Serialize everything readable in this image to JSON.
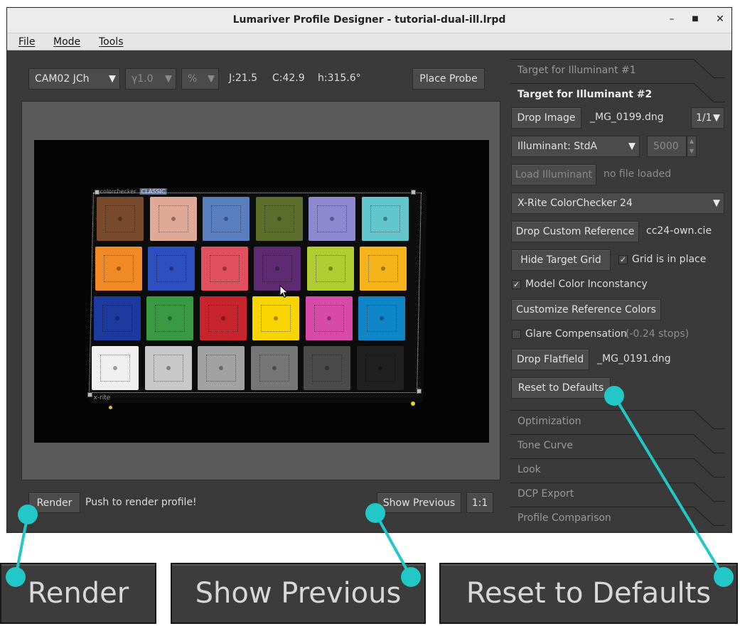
{
  "window": {
    "title": "Lumariver Profile Designer - tutorial-dual-ill.lrpd",
    "minimize": "–",
    "maximize": "■",
    "close": "✕"
  },
  "menu": [
    "File",
    "Mode",
    "Tools"
  ],
  "toolbar": {
    "colorspace": "CAM02 JCh",
    "gamma": "γ1.0",
    "unit": "%",
    "j": "J:21.5",
    "c": "C:42.9",
    "h": "h:315.6°",
    "place_probe": "Place Probe"
  },
  "bottom": {
    "render": "Render",
    "render_status": "Push to render profile!",
    "show_previous": "Show Previous",
    "zoom": "1:1"
  },
  "panel": {
    "tab_ill1": "Target for Illuminant #1",
    "tab_ill2": "Target for Illuminant #2",
    "drop_image": "Drop Image",
    "image_file": "_MG_0199.dng",
    "page_select": "1/1",
    "illuminant": "Illuminant: StdA",
    "temperature": "5000",
    "load_illuminant": "Load Illuminant",
    "illuminant_file": "no file loaded",
    "target_type": "X-Rite ColorChecker 24",
    "drop_custom_ref": "Drop Custom Reference",
    "custom_ref_file": "cc24-own.cie",
    "hide_grid": "Hide Target Grid",
    "grid_in_place": "Grid is in place",
    "grid_in_place_checked": true,
    "model_inconstancy": "Model Color Inconstancy",
    "model_inconstancy_checked": true,
    "customize_ref": "Customize Reference Colors",
    "glare": "Glare Compensation",
    "glare_value": "(-0.24 stops)",
    "glare_checked": false,
    "drop_flatfield": "Drop Flatfield",
    "flatfield_file": "_MG_0191.dng",
    "reset_defaults": "Reset to Defaults",
    "sections": [
      "Optimization",
      "Tone Curve",
      "Look",
      "DCP Export",
      "Profile Comparison"
    ]
  },
  "target_card": {
    "brand": "colorchecker",
    "brand_badge": "CLASSIC",
    "maker": "x-rite"
  },
  "patches": [
    [
      "#7a4a2c",
      "#e0a896",
      "#5a7fc0",
      "#5d6e2c",
      "#8e88d0",
      "#62c6cc"
    ],
    [
      "#f08a24",
      "#2e4fc0",
      "#e0505e",
      "#5e2a72",
      "#b0cc30",
      "#f4b41a"
    ],
    [
      "#1c3aa0",
      "#3a9a44",
      "#c8242e",
      "#f8d400",
      "#d84aa8",
      "#0e86c8"
    ],
    [
      "#f0f0f0",
      "#c8c8c8",
      "#a2a2a2",
      "#767676",
      "#4a4a4a",
      "#202020"
    ]
  ],
  "callouts": {
    "render": "Render",
    "show_previous": "Show Previous",
    "reset_defaults": "Reset to Defaults",
    "color": "#22c8c8"
  }
}
